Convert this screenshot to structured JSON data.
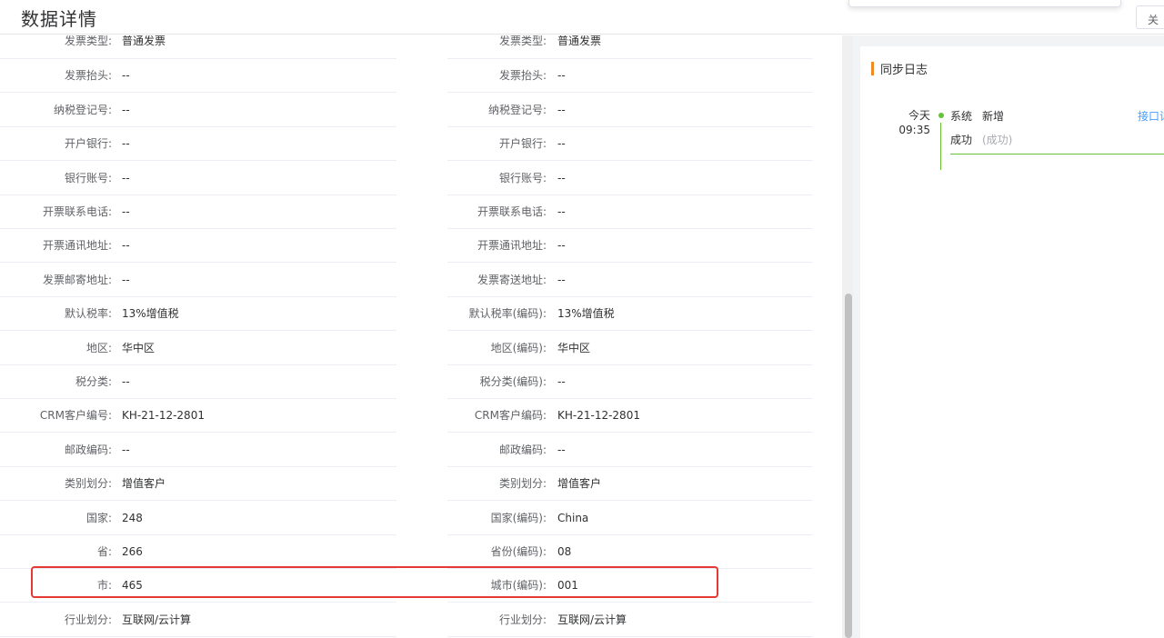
{
  "header": {
    "title": "数据详情",
    "close_label": "关"
  },
  "fields": [
    {
      "left_label": "发票类型:",
      "left_value": "普通发票",
      "right_label": "发票类型:",
      "right_value": "普通发票"
    },
    {
      "left_label": "发票抬头:",
      "left_value": "--",
      "right_label": "发票抬头:",
      "right_value": "--"
    },
    {
      "left_label": "纳税登记号:",
      "left_value": "--",
      "right_label": "纳税登记号:",
      "right_value": "--"
    },
    {
      "left_label": "开户银行:",
      "left_value": "--",
      "right_label": "开户银行:",
      "right_value": "--"
    },
    {
      "left_label": "银行账号:",
      "left_value": "--",
      "right_label": "银行账号:",
      "right_value": "--"
    },
    {
      "left_label": "开票联系电话:",
      "left_value": "--",
      "right_label": "开票联系电话:",
      "right_value": "--"
    },
    {
      "left_label": "开票通讯地址:",
      "left_value": "--",
      "right_label": "开票通讯地址:",
      "right_value": "--"
    },
    {
      "left_label": "发票邮寄地址:",
      "left_value": "--",
      "right_label": "发票寄送地址:",
      "right_value": "--"
    },
    {
      "left_label": "默认税率:",
      "left_value": "13%增值税",
      "right_label": "默认税率(编码):",
      "right_value": "13%增值税"
    },
    {
      "left_label": "地区:",
      "left_value": "华中区",
      "right_label": "地区(编码):",
      "right_value": "华中区"
    },
    {
      "left_label": "税分类:",
      "left_value": "--",
      "right_label": "税分类(编码):",
      "right_value": "--"
    },
    {
      "left_label": "CRM客户编号:",
      "left_value": "KH-21-12-2801",
      "right_label": "CRM客户编码:",
      "right_value": "KH-21-12-2801"
    },
    {
      "left_label": "邮政编码:",
      "left_value": "--",
      "right_label": "邮政编码:",
      "right_value": "--"
    },
    {
      "left_label": "类别划分:",
      "left_value": "增值客户",
      "right_label": "类别划分:",
      "right_value": "增值客户"
    },
    {
      "left_label": "国家:",
      "left_value": "248",
      "right_label": "国家(编码):",
      "right_value": "China"
    },
    {
      "left_label": "省:",
      "left_value": "266",
      "right_label": "省份(编码):",
      "right_value": "08"
    },
    {
      "left_label": "市:",
      "left_value": "465",
      "right_label": "城市(编码):",
      "right_value": "001"
    },
    {
      "left_label": "行业划分:",
      "left_value": "互联网/云计算",
      "right_label": "行业划分:",
      "right_value": "互联网/云计算"
    }
  ],
  "sync_log": {
    "title": "同步日志",
    "entries": [
      {
        "date": "今天",
        "time": "09:35",
        "source": "系统",
        "action": "新增",
        "link": "接口详情",
        "status": "成功",
        "status_detail": "(成功)"
      }
    ]
  },
  "colors": {
    "highlight": "#e53935",
    "accent": "#f08a24",
    "success": "#67c23a",
    "link": "#409eff"
  }
}
